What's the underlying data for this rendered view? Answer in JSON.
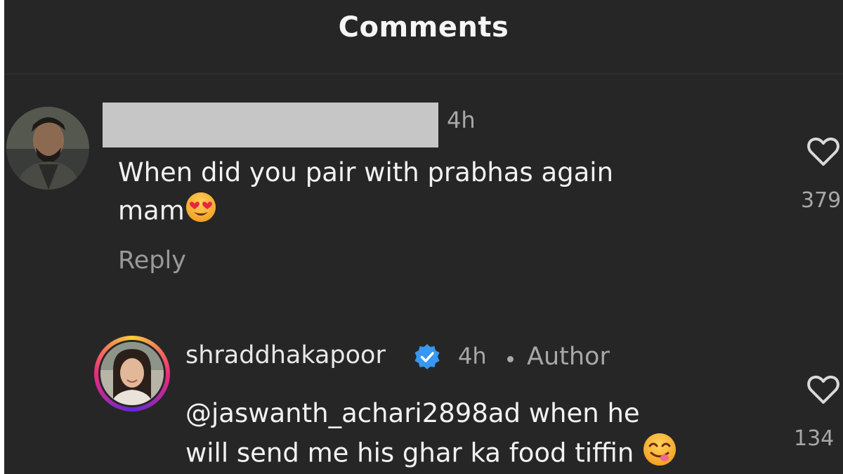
{
  "header": {
    "title": "Comments"
  },
  "comments": [
    {
      "username": "",
      "time": "4h",
      "text": "When did you pair with prabhas again",
      "text_line2": "mam",
      "emoji": "heart-eyes-emoji",
      "reply_label": "Reply",
      "likes": "379"
    },
    {
      "username": "shraddhakapoor",
      "verified": true,
      "time": "4h",
      "badge": "Author",
      "text": "@jaswanth_achari2898ad when he",
      "text_line2": "will send me his ghar ka food tiffin",
      "emoji": "yum-emoji",
      "likes": "134"
    }
  ],
  "colors": {
    "background": "#262626",
    "text": "#f2f2f2",
    "muted": "#a8a8a8",
    "verified": "#3897f0"
  }
}
